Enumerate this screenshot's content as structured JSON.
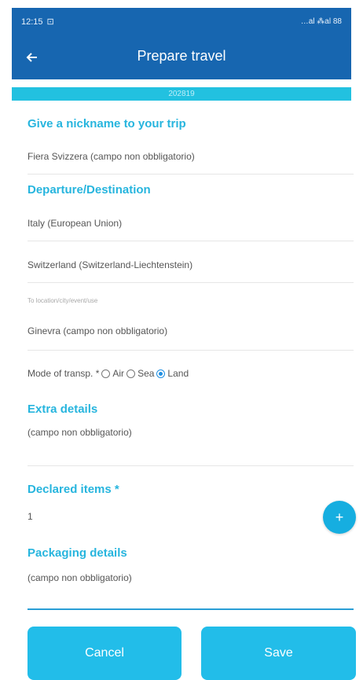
{
  "status_bar": {
    "time": "12:15",
    "indicators": "…al ⁂al 88"
  },
  "app_bar": {
    "title": "Prepare travel"
  },
  "sub_bar": {
    "code": "202819"
  },
  "sections": {
    "nickname": {
      "label": "Give a nickname to your trip",
      "value": "Fiera Svizzera (campo non obbligatorio)"
    },
    "departure_destination": {
      "label": "Departure/Destination",
      "departure": "Italy (European Union)",
      "destination": "Switzerland (Switzerland-Liechtenstein)",
      "location_label": "To location/city/event/use",
      "location_value": "Ginevra (campo non obbligatorio)"
    },
    "mode": {
      "label": "Mode of transp. *",
      "options": [
        "Air",
        "Sea",
        "Land"
      ],
      "selected": "Land"
    },
    "extra": {
      "label": "Extra details",
      "value": "(campo non obbligatorio)"
    },
    "declared": {
      "label": "Declared items *",
      "value": "1"
    },
    "packaging": {
      "label": "Packaging details",
      "value": "(campo non obbligatorio)"
    }
  },
  "fab": {
    "symbol": "+"
  },
  "buttons": {
    "cancel": "Cancel",
    "save": "Save"
  },
  "colors": {
    "primary": "#1766b0",
    "accent": "#22c1e0",
    "label": "#27b5de"
  }
}
